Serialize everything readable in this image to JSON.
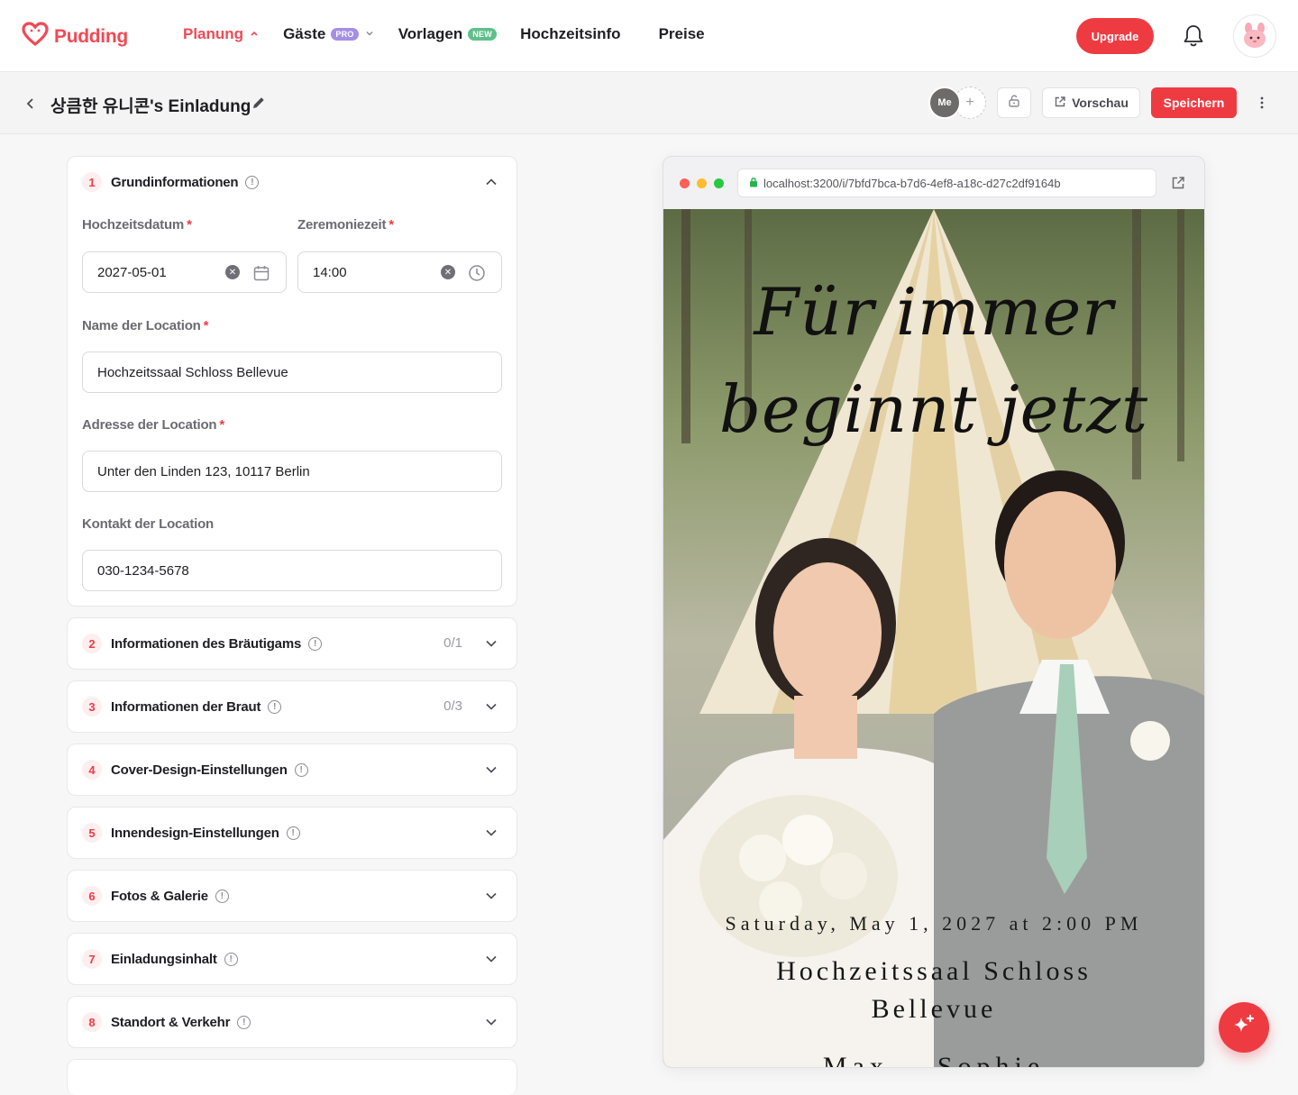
{
  "brand": {
    "name": "Pudding",
    "color": "#f04a55"
  },
  "nav": {
    "items": [
      {
        "label": "Planung",
        "active": true,
        "chevron": "up"
      },
      {
        "label": "Gäste",
        "badge": "PRO",
        "chevron": "down"
      },
      {
        "label": "Vorlagen",
        "badge": "NEW"
      },
      {
        "label": "Hochzeitsinfo"
      },
      {
        "label": "Preise"
      }
    ],
    "upgrade_label": "Upgrade"
  },
  "subheader": {
    "title": "상큼한 유니콘's Einladung",
    "collaborator_label": "Me",
    "add_collaborator": "+",
    "preview_label": "Vorschau",
    "save_label": "Speichern"
  },
  "basic_info": {
    "number": "1",
    "title": "Grundinformationen",
    "date_label": "Hochzeitsdatum",
    "date_value": "2027-05-01",
    "time_label": "Zeremoniezeit",
    "time_value": "14:00",
    "venue_label": "Name der Location",
    "venue_value": "Hochzeitssaal Schloss Bellevue",
    "address_label": "Adresse der Location",
    "address_value": "Unter den Linden 123, 10117 Berlin",
    "contact_label": "Kontakt der Location",
    "contact_value": "030-1234-5678",
    "required_mark": "*"
  },
  "sections": [
    {
      "number": "2",
      "title": "Informationen des Bräutigams",
      "count": "0/1"
    },
    {
      "number": "3",
      "title": "Informationen der Braut",
      "count": "0/3"
    },
    {
      "number": "4",
      "title": "Cover-Design-Einstellungen",
      "count": ""
    },
    {
      "number": "5",
      "title": "Innendesign-Einstellungen",
      "count": ""
    },
    {
      "number": "6",
      "title": "Fotos & Galerie",
      "count": ""
    },
    {
      "number": "7",
      "title": "Einladungsinhalt",
      "count": ""
    },
    {
      "number": "8",
      "title": "Standort & Verkehr",
      "count": ""
    }
  ],
  "preview": {
    "url": "localhost:3200/i/7bfd7bca-b7d6-4ef8-a18c-d27c2df9164b",
    "headline_line1": "Für immer",
    "headline_line2": "beginnt jetzt",
    "date_line": "Saturday, May 1, 2027 at 2:00 PM",
    "venue_line1": "Hochzeitssaal Schloss",
    "venue_line2": "Bellevue",
    "names_line": "Max    Sophie"
  },
  "colors": {
    "accent": "#ee3b42",
    "text": "#1f1f23",
    "muted": "#6b6b70"
  }
}
